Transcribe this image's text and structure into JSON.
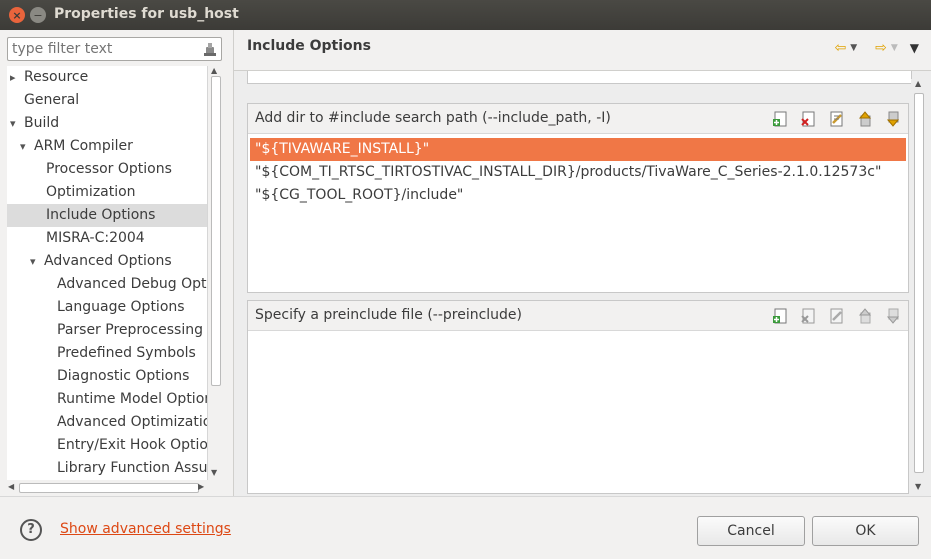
{
  "window": {
    "title": "Properties for usb_host"
  },
  "filter": {
    "placeholder": "type filter text"
  },
  "tree": {
    "items": [
      {
        "label": "Resource",
        "twisty": "collapsed"
      },
      {
        "label": "General",
        "twisty": "none"
      },
      {
        "label": "Build",
        "twisty": "expanded"
      },
      {
        "label": "ARM Compiler",
        "twisty": "expanded"
      },
      {
        "label": "Processor Options",
        "twisty": "none"
      },
      {
        "label": "Optimization",
        "twisty": "none"
      },
      {
        "label": "Include Options",
        "twisty": "none",
        "selected": true
      },
      {
        "label": "MISRA-C:2004",
        "twisty": "none"
      },
      {
        "label": "Advanced Options",
        "twisty": "expanded"
      },
      {
        "label": "Advanced Debug Optio",
        "twisty": "none"
      },
      {
        "label": "Language Options",
        "twisty": "none"
      },
      {
        "label": "Parser Preprocessing O",
        "twisty": "none"
      },
      {
        "label": "Predefined Symbols",
        "twisty": "none"
      },
      {
        "label": "Diagnostic Options",
        "twisty": "none"
      },
      {
        "label": "Runtime Model Option",
        "twisty": "none"
      },
      {
        "label": "Advanced Optimizatio",
        "twisty": "none"
      },
      {
        "label": "Entry/Exit Hook Option",
        "twisty": "none"
      },
      {
        "label": "Library Function Assum",
        "twisty": "none"
      }
    ]
  },
  "page": {
    "title": "Include Options"
  },
  "include_path_group": {
    "label": "Add dir to #include search path (--include_path, -I)",
    "entries": [
      "\"${TIVAWARE_INSTALL}\"",
      "\"${COM_TI_RTSC_TIRTOSTIVAC_INSTALL_DIR}/products/TivaWare_C_Series-2.1.0.12573c\"",
      "\"${CG_TOOL_ROOT}/include\""
    ]
  },
  "preinclude_group": {
    "label": "Specify a preinclude file (--preinclude)",
    "entries": []
  },
  "footer": {
    "advanced_link": "Show advanced settings",
    "cancel_label": "Cancel",
    "ok_label": "OK"
  },
  "colors": {
    "selection": "#f07746",
    "link": "#dd4814",
    "titlebar": "#3c3b37"
  }
}
